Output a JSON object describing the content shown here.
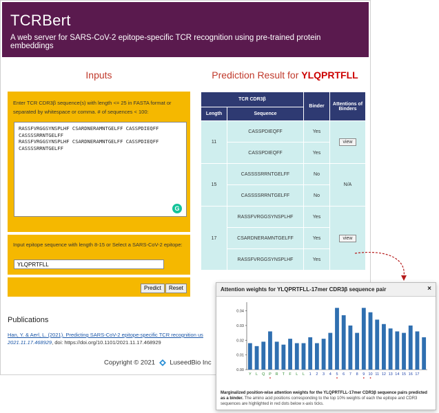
{
  "header": {
    "title": "TCRBert",
    "subtitle": "A web server for SARS-CoV-2 epitope-specific TCR recognition using pre-trained protein embeddings"
  },
  "inputs": {
    "heading": "Inputs",
    "instruction": "Enter TCR CDR3β sequence(s) with length <= 25 in FASTA format or separated by whitespace or comma. # of sequences < 100:",
    "cdr3_value": "RASSFVRGGSYNSPLHF CSARDNERAMNTGELFF CASSPDIEQFF\nCASSSSRRNTGELFF\nRASSFVRGGSYNSPLHF CSARDNERAMNTGELFF CASSPDIEQFF\nCASSSSRRNTGELFF",
    "epitope_label": "Input epitope sequence with length 8-15 or Select a SARS-CoV-2 epitope:",
    "epitope_value": "YLQPRTFLL",
    "predict_label": "Predict",
    "reset_label": "Reset"
  },
  "result": {
    "heading_prefix": "Prediction Result for",
    "epitope": "YLQPRTFLL",
    "col_group": "TCR CDR3β",
    "col_length": "Length",
    "col_sequence": "Sequence",
    "col_binder": "Binder",
    "col_attn": "Attentions of Binders",
    "groups": [
      {
        "length": "11",
        "attn": "view",
        "rows": [
          {
            "sequence": "CASSPDIEQFF",
            "binder": "Yes"
          },
          {
            "sequence": "CASSPDIEQFF",
            "binder": "Yes"
          }
        ]
      },
      {
        "length": "15",
        "attn": "N/A",
        "rows": [
          {
            "sequence": "CASSSSRRNTGELFF",
            "binder": "No"
          },
          {
            "sequence": "CASSSSRRNTGELFF",
            "binder": "No"
          }
        ]
      },
      {
        "length": "17",
        "attn": "view",
        "rows": [
          {
            "sequence": "RASSFVRGGSYNSPLHF",
            "binder": "Yes"
          },
          {
            "sequence": "CSARDNERAMNTGELFF",
            "binder": "Yes"
          },
          {
            "sequence": "RASSFVRGGSYNSPLHF",
            "binder": "Yes"
          }
        ]
      }
    ]
  },
  "publications": {
    "heading": "Publications",
    "citation": "Han, Y. & Aerl, L. (2021). Predicting SARS-CoV-2 epitope-specific TCR recognition us",
    "rest_italic": "2021.11.17.468929",
    "rest": ", doi: https://doi.org/10.1101/2021.11.17.468929"
  },
  "footer": {
    "copyright": "Copyright © 2021",
    "company": "LuseedBio Inc"
  },
  "popup": {
    "title": "Attention weights for YLQPRTFLL-17mer CDR3β sequence pair",
    "close": "×",
    "caption_bold": "Marginalized position-wise attention weights for the YLQPRTFLL-17mer CDR3β sequence pairs predicted as a binder.",
    "caption_rest": " The amino acid positions corresponding to the top 10% weights of each the epitope and CDR3 sequences are highlighted in red dots below x-axis ticks."
  },
  "chart_data": {
    "type": "bar",
    "categories": [
      "Y",
      "L",
      "Q",
      "P",
      "R",
      "T",
      "F",
      "L",
      "L",
      "1",
      "2",
      "3",
      "4",
      "5",
      "6",
      "7",
      "8",
      "9",
      "10",
      "11",
      "12",
      "13",
      "14",
      "15",
      "16",
      "17"
    ],
    "values": [
      0.018,
      0.016,
      0.019,
      0.026,
      0.019,
      0.017,
      0.021,
      0.018,
      0.018,
      0.022,
      0.018,
      0.021,
      0.025,
      0.042,
      0.037,
      0.03,
      0.025,
      0.042,
      0.039,
      0.034,
      0.031,
      0.028,
      0.026,
      0.025,
      0.03,
      0.026,
      0.022
    ],
    "yticks": [
      "0.00",
      "0.01",
      "0.02",
      "0.03",
      "0.04"
    ],
    "ylim": [
      0,
      0.044
    ],
    "highlighted": [
      3,
      13,
      17,
      18
    ],
    "bar_color": "#2f6fb0",
    "tick_colors": {
      "epitope": "#2e8b2e",
      "cdr3": "#1a3fa8"
    },
    "dot_color": "#cc2222"
  }
}
